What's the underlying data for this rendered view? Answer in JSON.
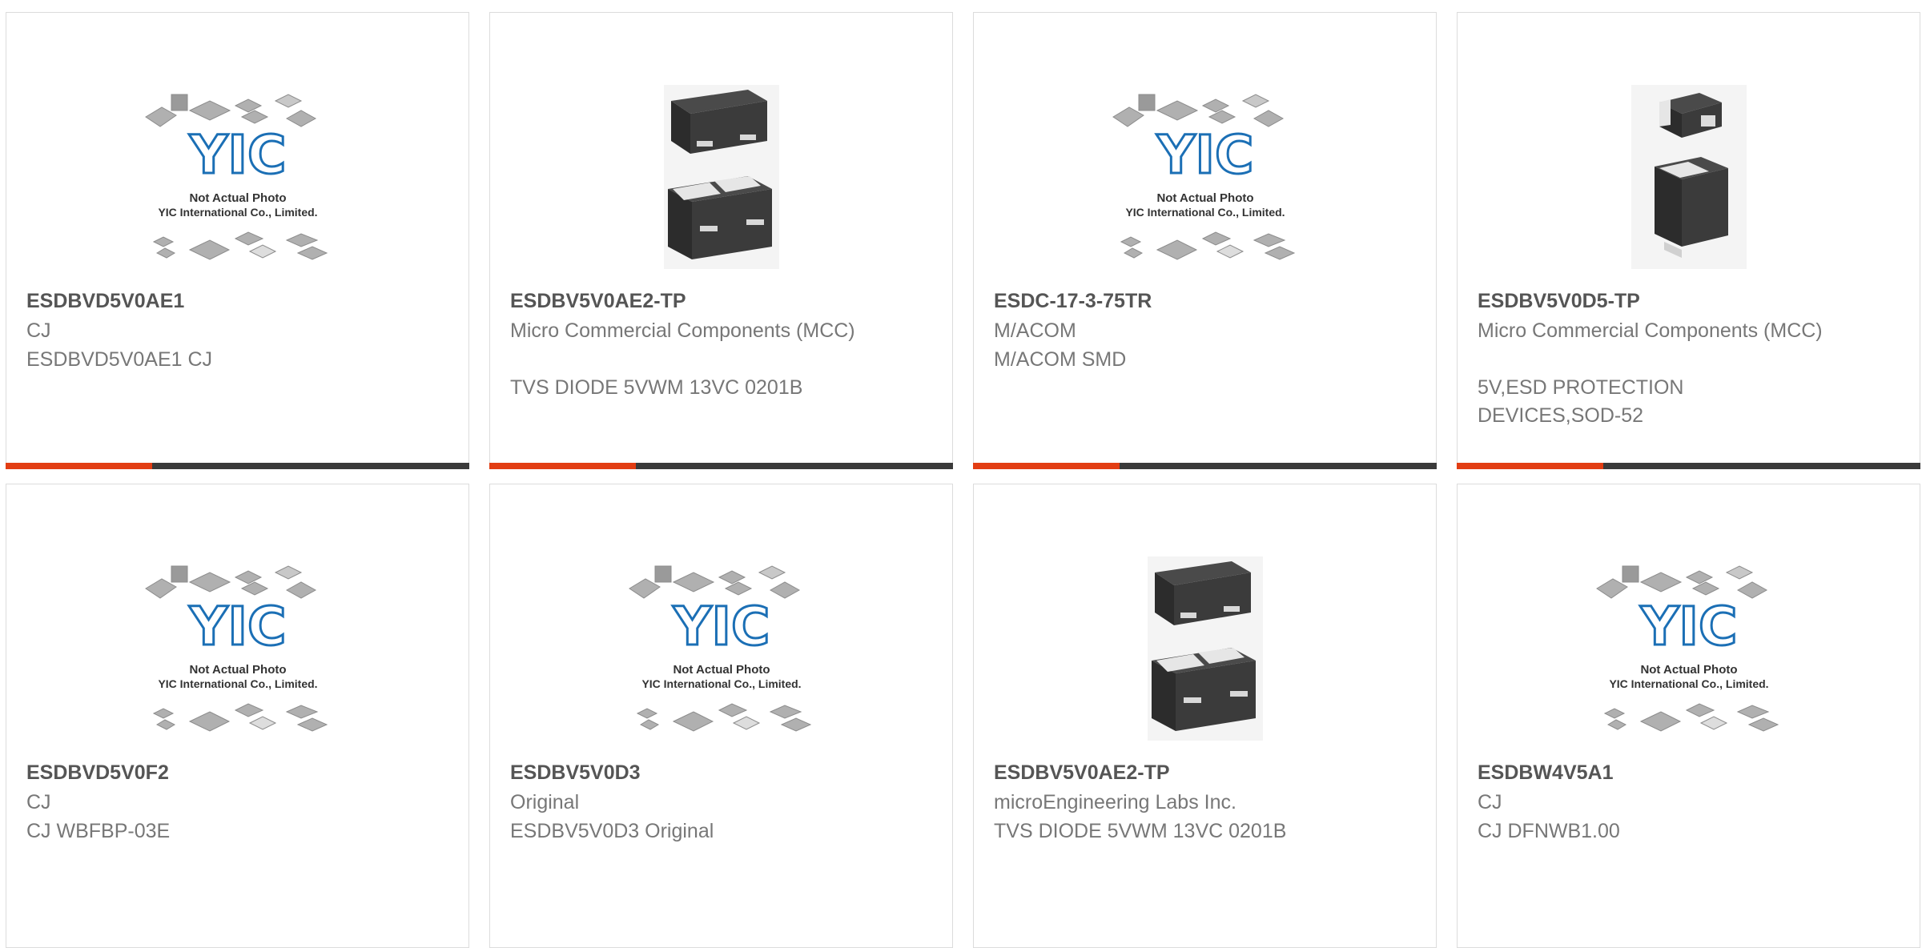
{
  "colors": {
    "accent": "#e23d13",
    "bar": "#3a3a3a",
    "card_border": "#dcdcdc",
    "logo_blue": "#1b6fb5"
  },
  "placeholder": {
    "line1": "Not Actual Photo",
    "line2": "YIC International Co., Limited.",
    "logo": "YIC"
  },
  "products": [
    {
      "part": "ESDBVD5V0AE1",
      "maker": "CJ",
      "desc": "ESDBVD5V0AE1 CJ",
      "image": "placeholder-image"
    },
    {
      "part": "ESDBV5V0AE2-TP",
      "maker": "Micro Commercial Components (MCC)",
      "desc": "TVS DIODE 5VWM 13VC 0201B",
      "image": "diode-package-image"
    },
    {
      "part": "ESDC-17-3-75TR",
      "maker": "M/ACOM",
      "desc": "M/ACOM SMD",
      "image": "placeholder-image"
    },
    {
      "part": "ESDBV5V0D5-TP",
      "maker": "Micro Commercial Components (MCC)",
      "desc": "5V,ESD PROTECTION DEVICES,SOD-52",
      "image": "diode-package-image"
    },
    {
      "part": "ESDBVD5V0F2",
      "maker": "CJ",
      "desc": "CJ WBFBP-03E",
      "image": "placeholder-image"
    },
    {
      "part": "ESDBV5V0D3",
      "maker": "Original",
      "desc": "ESDBV5V0D3 Original",
      "image": "placeholder-image"
    },
    {
      "part": "ESDBV5V0AE2-TP",
      "maker": "microEngineering Labs Inc.",
      "desc": "TVS DIODE 5VWM 13VC 0201B",
      "image": "diode-package-image"
    },
    {
      "part": "ESDBW4V5A1",
      "maker": "CJ",
      "desc": "CJ DFNWB1.00",
      "image": "placeholder-image"
    }
  ]
}
